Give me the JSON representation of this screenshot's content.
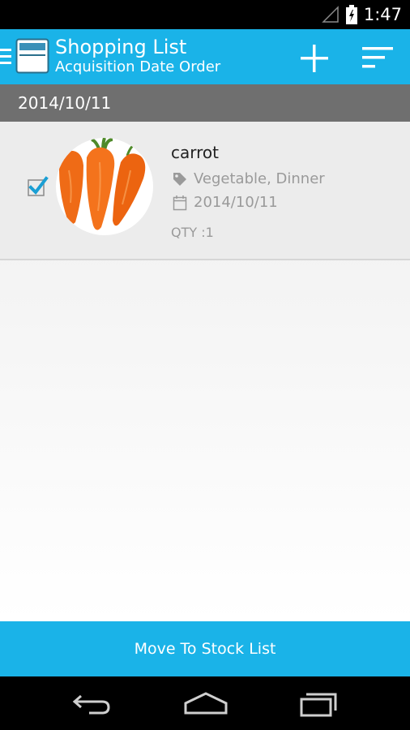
{
  "status_bar": {
    "time": "1:47",
    "signal_icon": "signal-icon",
    "battery_icon": "battery-charging-icon"
  },
  "action_bar": {
    "title": "Shopping List",
    "subtitle": "Acquisition Date Order",
    "drawer_icon": "drawer-indicator-icon",
    "app_icon": "app-list-icon",
    "add_icon": "plus-icon",
    "sort_icon": "sort-icon",
    "color": "#1ab3e8"
  },
  "section": {
    "date": "2014/10/11"
  },
  "items": [
    {
      "name": "carrot",
      "tags": "Vegetable, Dinner",
      "date": "2014/10/11",
      "qty": "QTY :1",
      "checked": true,
      "image": "carrot-photo",
      "tag_icon": "tag-icon",
      "date_icon": "calendar-icon"
    }
  ],
  "bottom_action": {
    "label": "Move To Stock List"
  },
  "nav_bar": {
    "back_icon": "back-icon",
    "home_icon": "home-icon",
    "recent_icon": "recent-apps-icon"
  }
}
